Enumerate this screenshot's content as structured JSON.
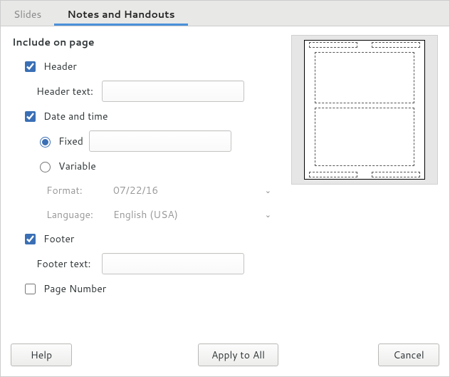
{
  "tabs": {
    "slides": "Slides",
    "notes": "Notes and Handouts"
  },
  "legend": "Include on page",
  "header": {
    "checkbox_label": "Header",
    "text_label": "Header text:",
    "text_value": ""
  },
  "datetime": {
    "checkbox_label": "Date and time",
    "fixed_label": "Fixed",
    "fixed_value": "",
    "variable_label": "Variable",
    "format_label": "Format:",
    "format_value": "07/22/16",
    "language_label": "Language:",
    "language_value": "English (USA)"
  },
  "footer": {
    "checkbox_label": "Footer",
    "text_label": "Footer text:",
    "text_value": ""
  },
  "pagenumber": {
    "checkbox_label": "Page Number"
  },
  "buttons": {
    "help": "Help",
    "apply_all": "Apply to All",
    "cancel": "Cancel"
  }
}
